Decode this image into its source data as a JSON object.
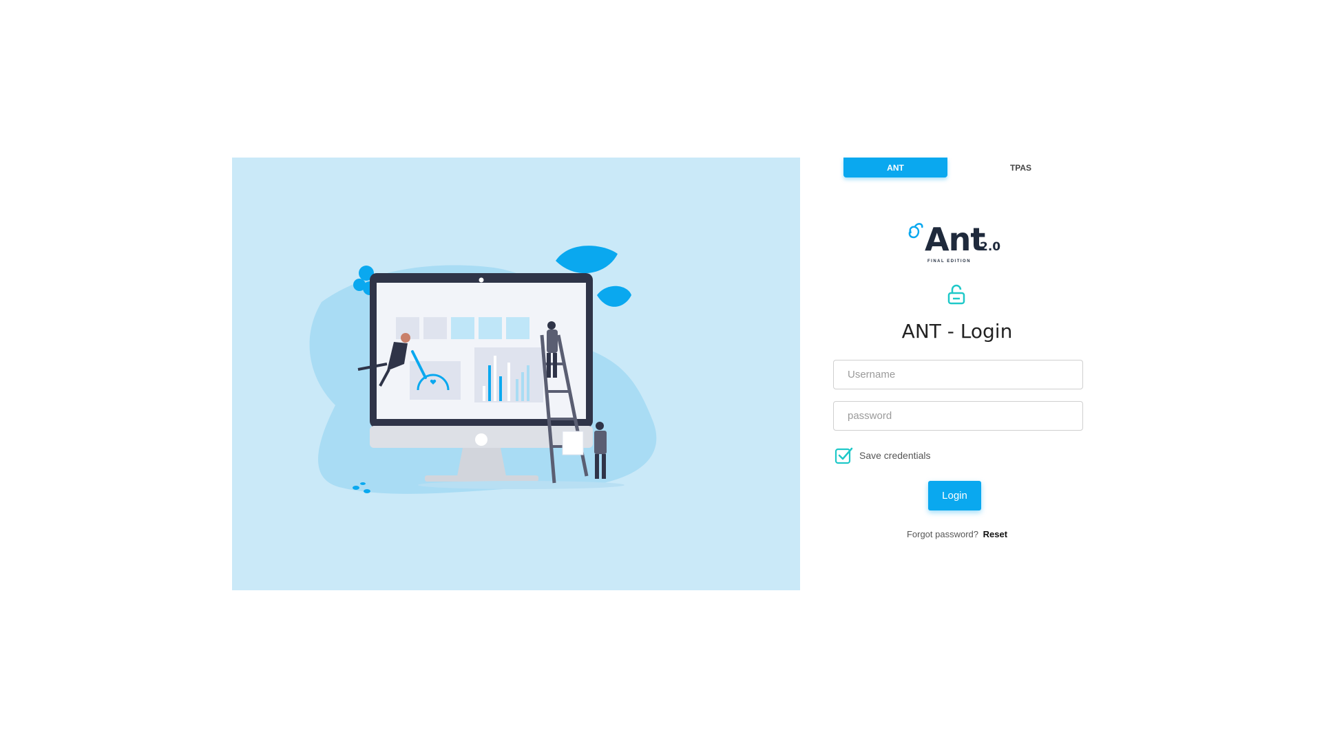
{
  "tabs": [
    {
      "label": "ANT",
      "active": true
    },
    {
      "label": "TPAS",
      "active": false
    }
  ],
  "logo": {
    "main": "Ant",
    "version": "2.0",
    "subtitle": "FINAL EDITION"
  },
  "icons": {
    "lock": "lock-open-icon",
    "checkbox": "checkbox-checked-icon"
  },
  "login": {
    "title": "ANT - Login",
    "username_placeholder": "Username",
    "password_placeholder": "password",
    "save_credentials_label": "Save credentials",
    "save_credentials_checked": true,
    "login_button": "Login",
    "forgot_text": "Forgot password?",
    "reset_link": "Reset"
  },
  "colors": {
    "accent": "#0aa8ef",
    "panel_bg": "#cae9f8",
    "lock_icon": "#1ec8c8",
    "checkbox": "#1ec8c8"
  }
}
